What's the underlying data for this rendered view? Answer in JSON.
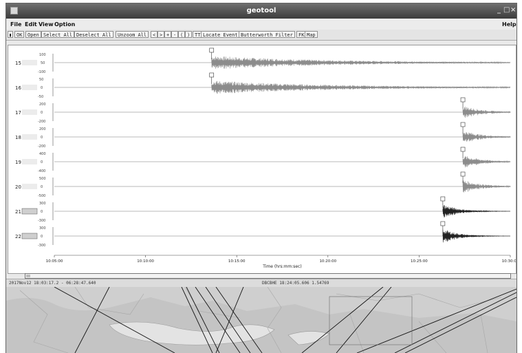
{
  "window": {
    "title": "geotool"
  },
  "menubar": {
    "file": "File",
    "edit": "Edit",
    "view": "View",
    "option": "Option",
    "help": "Help"
  },
  "toolbar": {
    "buttons": [
      "OK",
      "Open",
      "Select All",
      "Deselect All",
      "Unzoom All",
      "<",
      ">",
      "+",
      "-",
      "(",
      ")",
      "TT",
      "Locate Event",
      "Butterworth Filter",
      "FK",
      "Map"
    ]
  },
  "waveform": {
    "channels": [
      {
        "id": "15",
        "ticks": [
          "100",
          "50",
          "-100"
        ],
        "arrival": "0.345"
      },
      {
        "id": "16",
        "ticks": [
          "50",
          "0",
          "-50"
        ],
        "arrival": "0.345"
      },
      {
        "id": "17",
        "ticks": [
          "200",
          "0",
          "-200"
        ],
        "arrival": "0.896"
      },
      {
        "id": "18",
        "ticks": [
          "200",
          "0",
          "-200"
        ],
        "arrival": "0.896"
      },
      {
        "id": "19",
        "ticks": [
          "400",
          "0",
          "-400"
        ],
        "arrival": "0.896"
      },
      {
        "id": "20",
        "ticks": [
          "500",
          "0",
          "-500"
        ],
        "arrival": "0.896"
      },
      {
        "id": "21",
        "ticks": [
          "300",
          "0",
          "-300"
        ],
        "arrival": "0.852"
      },
      {
        "id": "22",
        "ticks": [
          "300",
          "0",
          "-300"
        ],
        "arrival": "0.852"
      }
    ],
    "xaxis": {
      "label": "Time (hrs:mm:sec)",
      "ticks": [
        "10:05:00",
        "10:10:00",
        "10:15:00",
        "10:20:00",
        "10:25:00",
        "10:30:00"
      ]
    }
  },
  "status": {
    "left": "2017Nov12 18:03:17.2 - 06:28:47.640",
    "center": "DBCBHE 18:24:05.606 1.54769"
  },
  "colors": {
    "titlebar": "#4a4a4a",
    "waveform_dark": "#222222",
    "waveform_light": "#8c8c8c",
    "map_land": "#cfcfcf",
    "map_sea": "#e2e2e2"
  }
}
